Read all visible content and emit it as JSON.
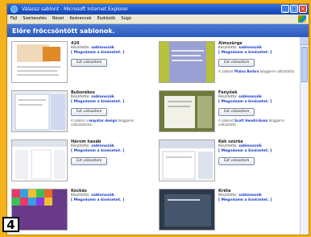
{
  "window": {
    "title": "Válassz sablont - Microsoft Internet Explorer"
  },
  "menu": [
    "Fájl",
    "Szerkesztés",
    "Nézet",
    "Kedvencek",
    "Eszközök",
    "Súgó"
  ],
  "header": {
    "title": "Előre fröccsöntött sablonok."
  },
  "labels": {
    "author": "Készítette:",
    "preview": "[ Megnézem a kinézetet. ]",
    "select": "Ezt választom"
  },
  "templates": [
    {
      "name": "420",
      "author": "sablonozók"
    },
    {
      "name": "Almszürge",
      "author": "sablonozók",
      "note_pre": "A sablont ",
      "note_hl": "Plaina Barbra",
      "note_post": " bloggerre változtatta."
    },
    {
      "name": "Buborékos",
      "author": "sablonozók",
      "note_pre": "A sablon a ",
      "note_hl": "mayatar design",
      "note_post": " bloggeres változatának."
    },
    {
      "name": "Fenyőek",
      "author": "sablonozók",
      "note_pre": "A sablont ",
      "note_hl": "Scott Hendrickson",
      "note_post": " bloggerre változtatta."
    },
    {
      "name": "Három hasáb",
      "author": "sablonozók"
    },
    {
      "name": "Kék szürke",
      "author": "sablonozók"
    },
    {
      "name": "Kockás",
      "author": "sablonozók"
    },
    {
      "name": "Kréta",
      "author": "sablonozók"
    }
  ],
  "badge": "4",
  "colors": {
    "background": "#f3b11c",
    "header": "#2a57b9",
    "link": "#1a3cc2"
  }
}
